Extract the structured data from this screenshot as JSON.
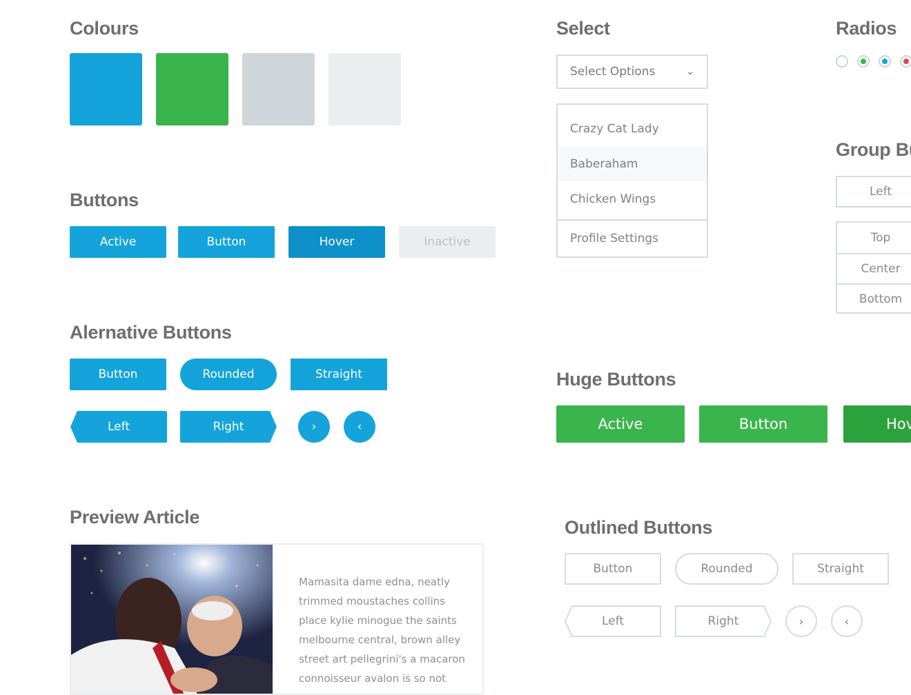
{
  "sections": {
    "colours": "Colours",
    "buttons": "Buttons",
    "alt_buttons": "Alernative Buttons",
    "preview_article": "Preview Article",
    "select": "Select",
    "radios": "Radios",
    "group_buttons": "Group Bu",
    "huge_buttons": "Huge Buttons",
    "outlined_buttons": "Outlined Buttons"
  },
  "colours": [
    "#14a4db",
    "#3ab54b",
    "#cfd6d9",
    "#ebeeef"
  ],
  "buttons": {
    "active": "Active",
    "button": "Button",
    "hover": "Hover",
    "inactive": "Inactive"
  },
  "alt_buttons": {
    "button": "Button",
    "rounded": "Rounded",
    "straight": "Straight",
    "left": "Left",
    "right": "Right"
  },
  "select": {
    "placeholder": "Select Options",
    "options": [
      "Crazy Cat Lady",
      "Baberaham",
      "Chicken Wings"
    ],
    "footer_option": "Profile Settings"
  },
  "radios": {
    "colors": [
      "",
      "#3ab54b",
      "#14a4db",
      "#e0484e"
    ]
  },
  "group_buttons": {
    "horizontal": [
      "Left"
    ],
    "vertical": [
      "Top",
      "Center",
      "Bottom"
    ]
  },
  "huge_buttons": {
    "active": "Active",
    "button": "Button",
    "hover": "Hov"
  },
  "outlined_buttons": {
    "button": "Button",
    "rounded": "Rounded",
    "straight": "Straight",
    "left": "Left",
    "right": "Right"
  },
  "article": {
    "text": "Mamasita dame edna, neatly trimmed moustaches collins place kylie minogue the saints melbourne central, brown alley street art pellegrini's a macaron connoisseur avalon is so not"
  }
}
